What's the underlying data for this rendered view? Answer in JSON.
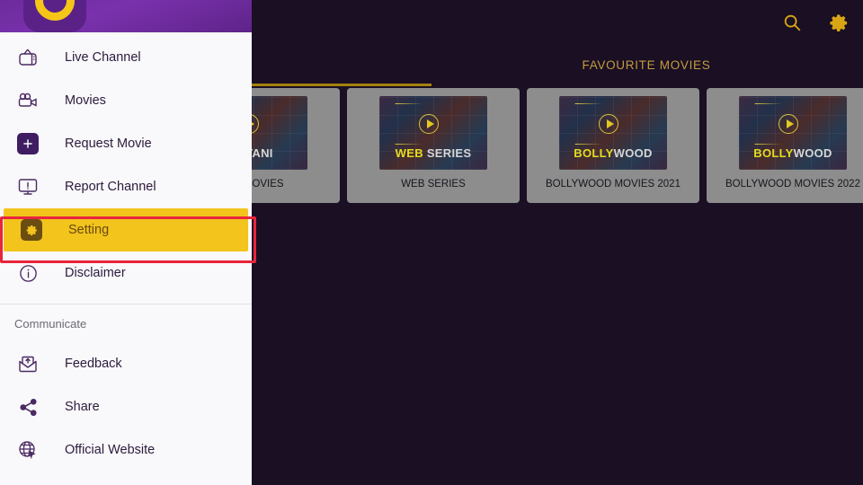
{
  "topbar": {
    "search_icon": "search-icon",
    "settings_icon": "gear-icon"
  },
  "tabs": [
    {
      "label": "",
      "active": true,
      "icon": ""
    },
    {
      "label": "FAVOURITE MOVIES",
      "active": false,
      "icon": ""
    }
  ],
  "tab_active_label": "FAVOURITE MOVIES",
  "cards": [
    {
      "label": "ANI MOVIES",
      "brand_1": "",
      "brand_2": "ISTANI",
      "truncated": true
    },
    {
      "label": "WEB SERIES",
      "brand_1": "WEB ",
      "brand_2": "SERIES",
      "truncated": false
    },
    {
      "label": "BOLLYWOOD MOVIES 2021",
      "brand_1": "BOLLY",
      "brand_2": "WOOD",
      "truncated": false
    },
    {
      "label": "BOLLYWOOD MOVIES 2022",
      "brand_1": "BOLLY",
      "brand_2": "WOOD",
      "truncated": false
    }
  ],
  "drawer": {
    "logo_name": "app-logo",
    "items": [
      {
        "label": "Live Channel",
        "icon": "tv-icon",
        "selected": false
      },
      {
        "label": "Movies",
        "icon": "movie-camera-icon",
        "selected": false
      },
      {
        "label": "Request Movie",
        "icon": "plus-square-icon",
        "selected": false
      },
      {
        "label": "Report Channel",
        "icon": "monitor-alert-icon",
        "selected": false
      },
      {
        "label": "Setting",
        "icon": "gear-square-icon",
        "selected": true
      },
      {
        "label": "Disclaimer",
        "icon": "info-circle-icon",
        "selected": false
      }
    ],
    "section_title": "Communicate",
    "communicate_items": [
      {
        "label": "Feedback",
        "icon": "envelope-up-icon",
        "selected": false
      },
      {
        "label": "Share",
        "icon": "share-icon",
        "selected": false
      },
      {
        "label": "Official Website",
        "icon": "globe-cursor-icon",
        "selected": false
      }
    ]
  },
  "annotation": {
    "target": "Setting",
    "color": "#e8253d"
  },
  "colors": {
    "accent_gold": "#f2c41c",
    "drawer_bg": "#f9f8fa",
    "content_bg": "#1a0f23",
    "purple": "#6c2b9c",
    "annotation_red": "#e8253d"
  }
}
